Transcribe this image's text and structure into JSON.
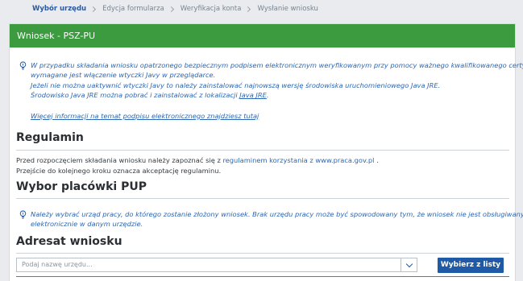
{
  "breadcrumb": {
    "items": [
      "Wybór urzędu",
      "Edycja formularza",
      "Weryfikacja konta",
      "Wysłanie wniosku"
    ]
  },
  "header": {
    "title": "Wniosek - PSZ-PU"
  },
  "java_info": {
    "line1": "W przypadku składania wniosku opatrzonego bezpiecznym podpisem elektronicznym weryfikowanym przy pomocy ważnego kwalifikowanego certyfikatu",
    "line2": "wymagane jest włączenie wtyczki Javy w przeglądarce.",
    "line3": "Jeżeli nie można uaktywnić wtyczki Javy to należy zainstalować najnowszą wersję środowiska uruchomieniowego Java JRE.",
    "line4_prefix": "Środowisko Java JRE można pobrać i zainstalować z lokalizacji ",
    "line4_link": "Java JRE",
    "line4_suffix": ".",
    "more_link": "Więcej informacji na temat podpisu elektronicznego znajdziesz tutaj"
  },
  "regulamin": {
    "title": "Regulamin",
    "text1_prefix": "Przed rozpoczęciem składania wniosku należy zapoznać się z ",
    "text1_link": "regulaminem korzystania z www.praca.gov.pl",
    "text1_suffix": " .",
    "text2": "Przejście do kolejnego kroku oznacza akceptację regulaminu."
  },
  "placowka": {
    "title": "Wybor placówki PUP",
    "info_line1": "Należy wybrać urząd pracy, do którego zostanie złożony wniosek. Brak urzędu pracy może być spowodowany tym, że wniosek nie jest obsługiwany",
    "info_line2": "elektronicznie w danym urzędzie."
  },
  "adresat": {
    "title": "Adresat wniosku",
    "select_placeholder": "Podaj nazwę urzędu...",
    "button_label": "Wybierz z listy"
  }
}
